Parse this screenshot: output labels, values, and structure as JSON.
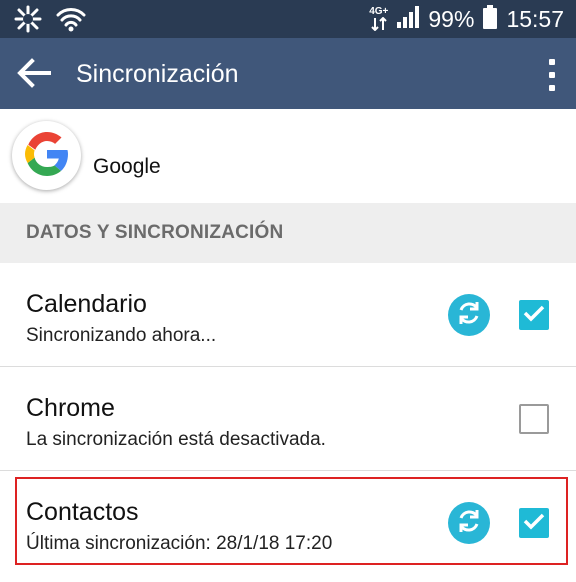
{
  "status_bar": {
    "network": "4G+",
    "battery_percent": "99%",
    "time": "15:57",
    "icons": [
      "brightness-icon",
      "wifi-icon",
      "lte-data-icon",
      "signal-icon",
      "battery-icon"
    ]
  },
  "app_bar": {
    "title": "Sincronización",
    "icons": [
      "back-arrow-icon",
      "overflow-menu-icon"
    ]
  },
  "account": {
    "name": "Google",
    "icon": "google-logo-icon"
  },
  "section": {
    "title": "DATOS Y SINCRONIZACIÓN"
  },
  "sync_items": [
    {
      "title": "Calendario",
      "subtitle": "Sincronizando ahora...",
      "syncing_icon": true,
      "checked": true
    },
    {
      "title": "Chrome",
      "subtitle": "La sincronización está desactivada.",
      "syncing_icon": false,
      "checked": false
    },
    {
      "title": "Contactos",
      "subtitle": "Última sincronización: 28/1/18 17:20",
      "syncing_icon": true,
      "checked": true,
      "highlighted": true
    }
  ],
  "colors": {
    "status_bar": "#2a3b53",
    "app_bar": "#40577a",
    "accent": "#1fbad6",
    "section_bg": "#eeeeee",
    "highlight_border": "#dd2222"
  }
}
